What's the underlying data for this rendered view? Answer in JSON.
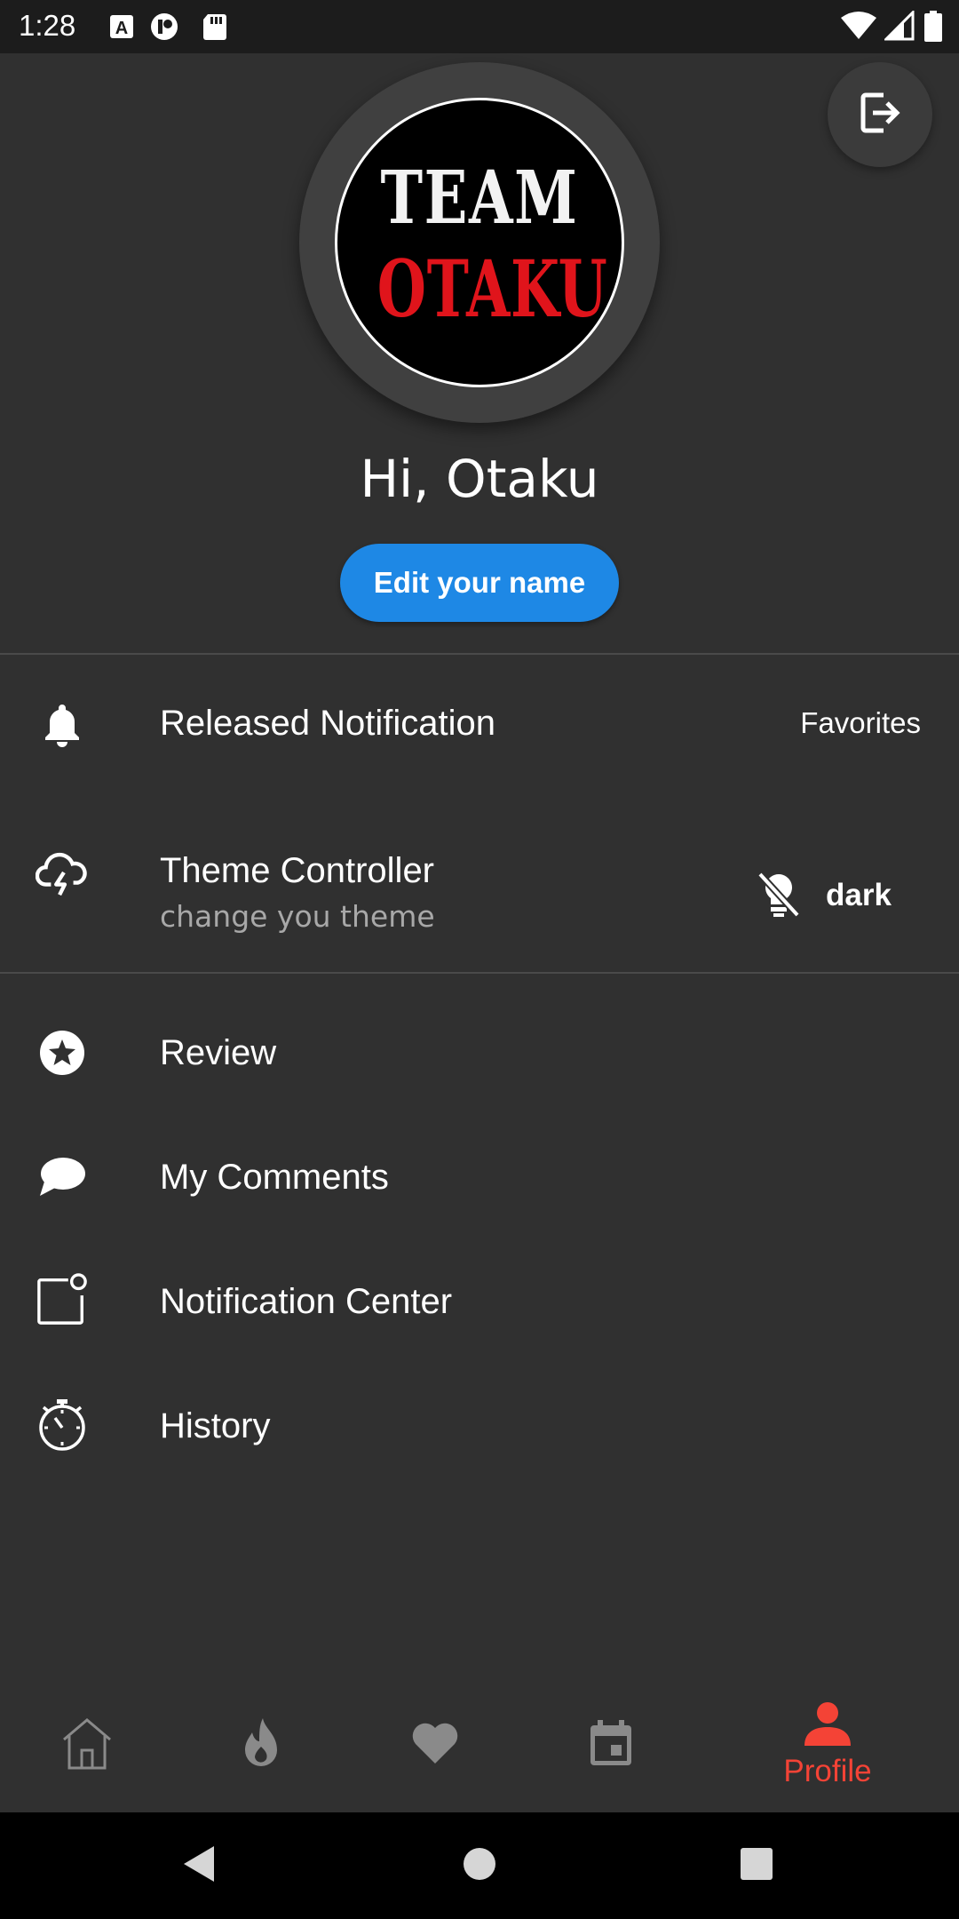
{
  "status_bar": {
    "time": "1:28",
    "left_icons": [
      "font-a-icon",
      "app-p-icon",
      "sd-card-icon"
    ],
    "right_icons": [
      "wifi-icon",
      "cell-signal-icon",
      "battery-icon"
    ]
  },
  "profile": {
    "avatar_logo_line1": "TEAM",
    "avatar_logo_line2": "OTAKU",
    "greeting": "Hi, Otaku",
    "edit_name_label": "Edit your name",
    "logout_icon": "logout-icon"
  },
  "settings": {
    "released_notification": {
      "icon": "bell-icon",
      "label": "Released Notification",
      "value": "Favorites"
    },
    "theme_controller": {
      "icon": "cloud-lightning-icon",
      "label": "Theme Controller",
      "subtitle": "change you theme",
      "value": "dark",
      "value_icon": "lightbulb-off-icon"
    }
  },
  "menu": {
    "items": [
      {
        "label": "Review",
        "icon": "star-circle-icon"
      },
      {
        "label": "My Comments",
        "icon": "comment-icon"
      },
      {
        "label": "Notification Center",
        "icon": "notification-badge-icon"
      },
      {
        "label": "History",
        "icon": "stopwatch-icon"
      }
    ]
  },
  "bottom_nav": {
    "items": [
      {
        "icon": "home-icon",
        "label": ""
      },
      {
        "icon": "fire-icon",
        "label": ""
      },
      {
        "icon": "heart-icon",
        "label": ""
      },
      {
        "icon": "calendar-icon",
        "label": ""
      },
      {
        "icon": "person-icon",
        "label": "Profile",
        "active": true
      }
    ],
    "active_color": "#f44336",
    "inactive_color": "#8a8a8a"
  },
  "colors": {
    "background": "#303030",
    "primary_button": "#1e88e5",
    "accent": "#f44336"
  }
}
